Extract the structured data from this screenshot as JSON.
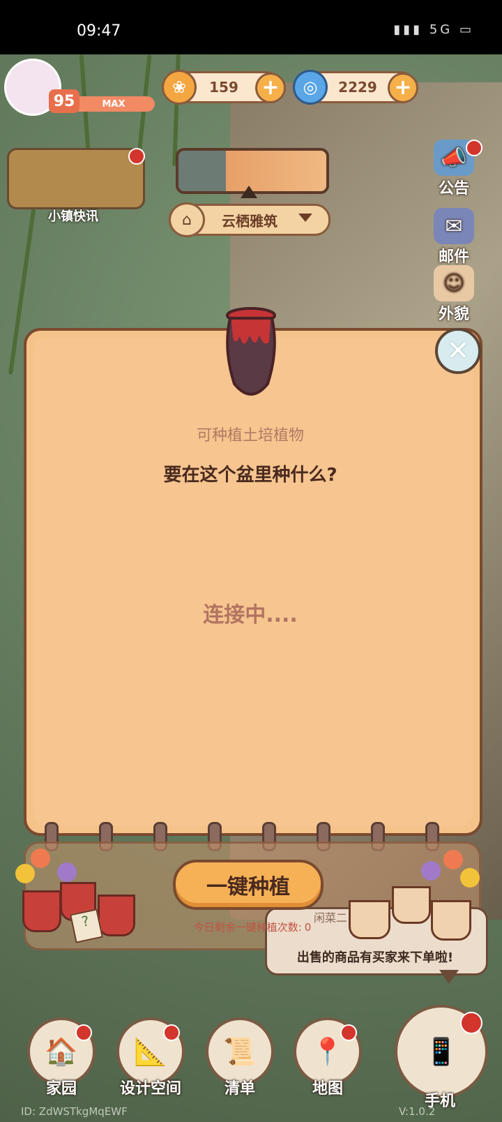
{
  "status_bar": {
    "time": "09:47",
    "icons": "5G"
  },
  "hud": {
    "level": "95",
    "level_bar_text": "MAX",
    "currency1_value": "159",
    "currency2_value": "2229",
    "plus_label": "+"
  },
  "news": {
    "label": "小镇快讯"
  },
  "location": {
    "name": "云栖雅筑"
  },
  "side_menu": {
    "announcement": "公告",
    "mail": "邮件",
    "appearance": "外貌"
  },
  "dialog": {
    "item_type": "可种植土培植物",
    "question": "要在这个盆里种什么?",
    "status": "连接中....",
    "close_symbol": "✕"
  },
  "plant_panel": {
    "button_label": "一键种植",
    "remaining_label": "今日剩余一键种植次数:",
    "remaining_count": "0"
  },
  "notification": {
    "title": "闲菜二",
    "text": "出售的商品有买家来下单啦!"
  },
  "bottom_nav": {
    "home": "家园",
    "design": "设计空间",
    "list": "清单",
    "map": "地图",
    "phone": "手机"
  },
  "footer": {
    "id": "ID: ZdWSTkgMqEWF",
    "version": "V:1.0.2"
  },
  "colors": {
    "dialog_bg": "#f5c28a",
    "border_brown": "#7a4a2e",
    "button_orange": "#f6b157",
    "alert_red": "#d2352b"
  }
}
